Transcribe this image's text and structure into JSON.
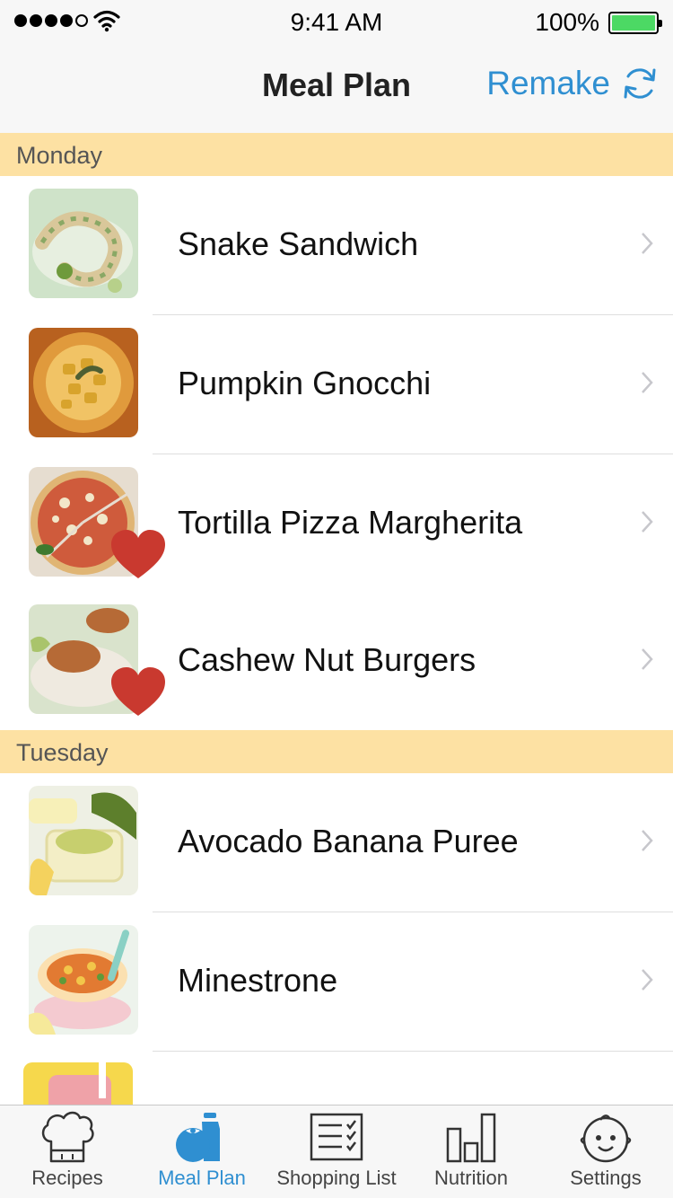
{
  "status_bar": {
    "time": "9:41 AM",
    "battery": "100%"
  },
  "nav": {
    "title": "Meal Plan",
    "remake_label": "Remake"
  },
  "sections": [
    {
      "day": "Monday",
      "items": [
        {
          "name": "Snake Sandwich",
          "favorite": false
        },
        {
          "name": "Pumpkin Gnocchi",
          "favorite": false
        },
        {
          "name": "Tortilla Pizza Margherita",
          "favorite": true
        },
        {
          "name": "Cashew Nut Burgers",
          "favorite": true
        }
      ]
    },
    {
      "day": "Tuesday",
      "items": [
        {
          "name": "Avocado Banana Puree",
          "favorite": false
        },
        {
          "name": "Minestrone",
          "favorite": false
        }
      ]
    }
  ],
  "tabs": [
    {
      "label": "Recipes",
      "icon": "chef-hat-icon",
      "active": false
    },
    {
      "label": "Meal Plan",
      "icon": "meal-plan-icon",
      "active": true
    },
    {
      "label": "Shopping List",
      "icon": "checklist-icon",
      "active": false
    },
    {
      "label": "Nutrition",
      "icon": "bar-chart-icon",
      "active": false
    },
    {
      "label": "Settings",
      "icon": "baby-face-icon",
      "active": false
    }
  ],
  "colors": {
    "accent": "#2f8fd1",
    "section_header": "#fde1a3",
    "heart": "#c9392f",
    "battery": "#4cd964"
  }
}
